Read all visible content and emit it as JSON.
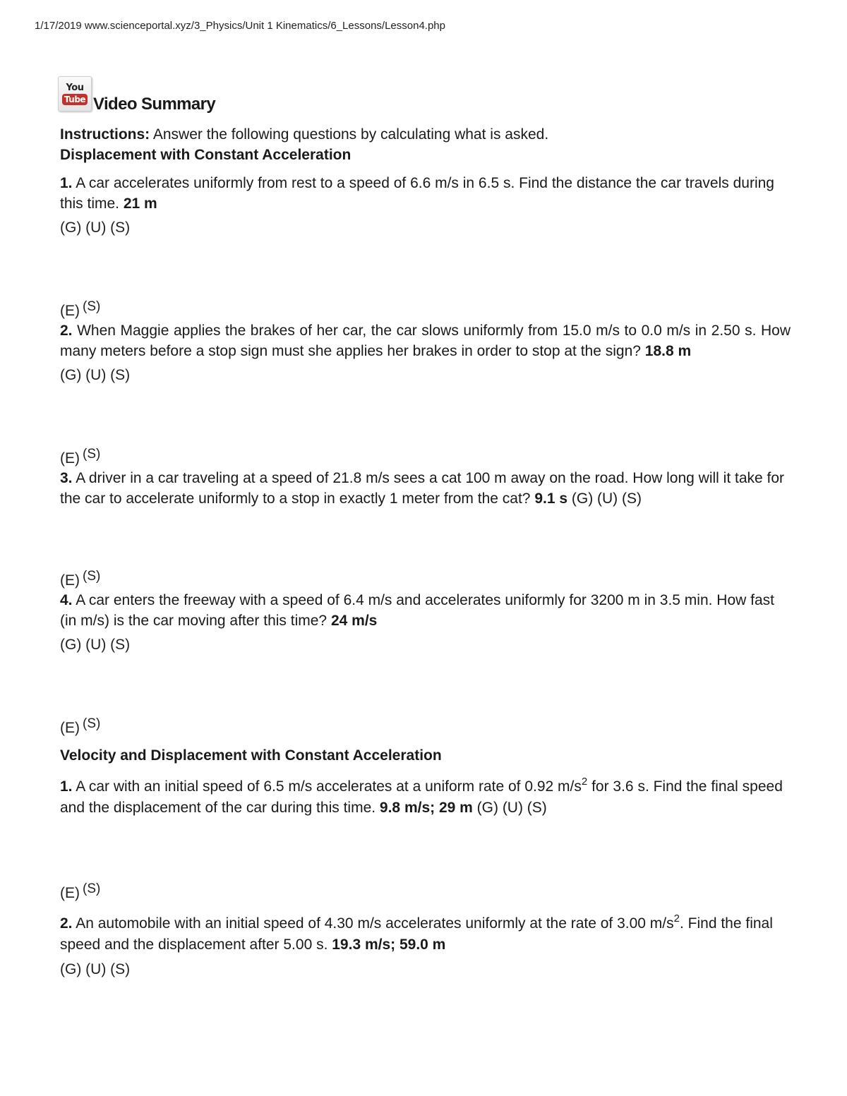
{
  "print_header": "1/17/2019 www.scienceportal.xyz/3_Physics/Unit 1 Kinematics/6_Lessons/Lesson4.php",
  "logo": {
    "icon": "youtube-icon",
    "you": "You",
    "tube": "Tube"
  },
  "page_title": "Video Summary",
  "instructions": {
    "label": "Instructions:",
    "text": " Answer the following questions by calculating what is asked."
  },
  "steps_label": "(G) (U) (S)",
  "es_E": "(E)",
  "es_S": "(S)",
  "section1": {
    "title": "Displacement with Constant Acceleration",
    "questions": [
      {
        "num": "1.",
        "text": " A car accelerates uniformly from rest to a speed of 6.6 m/s in 6.5 s. Find the distance the car travels during this time. ",
        "answer": "21 m"
      },
      {
        "num": "2.",
        "text": " When Maggie applies the brakes of her car, the car slows uniformly from 15.0 m/s to 0.0 m/s in 2.50 s. How many meters before a stop sign must she applies her brakes in order to stop at the sign? ",
        "answer": "18.8 m"
      },
      {
        "num": "3.",
        "text": " A driver in a car traveling at a speed of 21.8 m/s sees a cat 100 m away on the road. How long will it take for the car to accelerate uniformly to a stop in exactly 1 meter from the cat? ",
        "answer": "9.1 s",
        "steps": " (G) (U) (S)"
      },
      {
        "num": "4.",
        "text": " A car enters the freeway with a speed of 6.4 m/s and accelerates uniformly for 3200 m in 3.5 min. How fast (in m/s) is the car moving after this time? ",
        "answer": "24 m/s"
      }
    ]
  },
  "section2": {
    "title": "Velocity and Displacement with Constant Acceleration",
    "questions": [
      {
        "num": "1.",
        "text_a": " A car with an initial speed of 6.5 m/s accelerates at a uniform rate of 0.92 m/s",
        "power": "2",
        "text_b": " for 3.6 s. Find the final speed and the displacement of the car during this time. ",
        "answer": "9.8 m/s; 29 m",
        "steps": " (G) (U) (S)"
      },
      {
        "num": "2.",
        "text_a": " An automobile with an initial speed of 4.30 m/s accelerates uniformly at the rate of 3.00 m/s",
        "power": "2",
        "text_b": ". Find the final speed and the displacement after 5.00 s. ",
        "answer": "19.3 m/s; 59.0 m"
      }
    ]
  }
}
